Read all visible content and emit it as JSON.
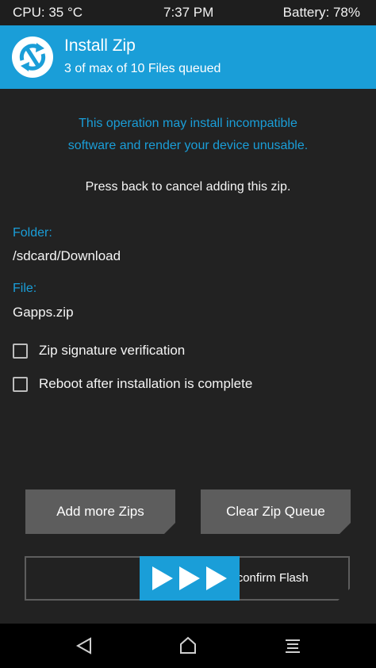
{
  "status_bar": {
    "cpu": "CPU: 35 °C",
    "time": "7:37 PM",
    "battery": "Battery: 78%"
  },
  "header": {
    "title": "Install Zip",
    "subtitle": "3 of max of 10 Files queued",
    "logo_icon": "twrp-logo-icon"
  },
  "main": {
    "warning_line1": "This operation may install incompatible",
    "warning_line2": "software and render your device unusable.",
    "cancel_text": "Press back to cancel adding this zip.",
    "folder_label": "Folder:",
    "folder_value": "/sdcard/Download",
    "file_label": "File:",
    "file_value": "Gapps.zip",
    "checkboxes": [
      {
        "label": "Zip signature verification",
        "checked": false
      },
      {
        "label": "Reboot after installation is complete",
        "checked": false
      }
    ]
  },
  "buttons": {
    "add_more": "Add more Zips",
    "clear_queue": "Clear Zip Queue"
  },
  "slider": {
    "label": "wipe to confirm Flash",
    "thumb_icon": "triple-play-arrows-icon"
  },
  "nav_bar": {
    "icons": [
      "back-triangle-icon",
      "home-pentagon-icon",
      "menu-lines-icon"
    ]
  },
  "colors": {
    "accent": "#1a9ed8",
    "background": "#222222",
    "button": "#5d5d5d",
    "status_bar": "#1e1e1e",
    "nav_bar": "#000000"
  }
}
